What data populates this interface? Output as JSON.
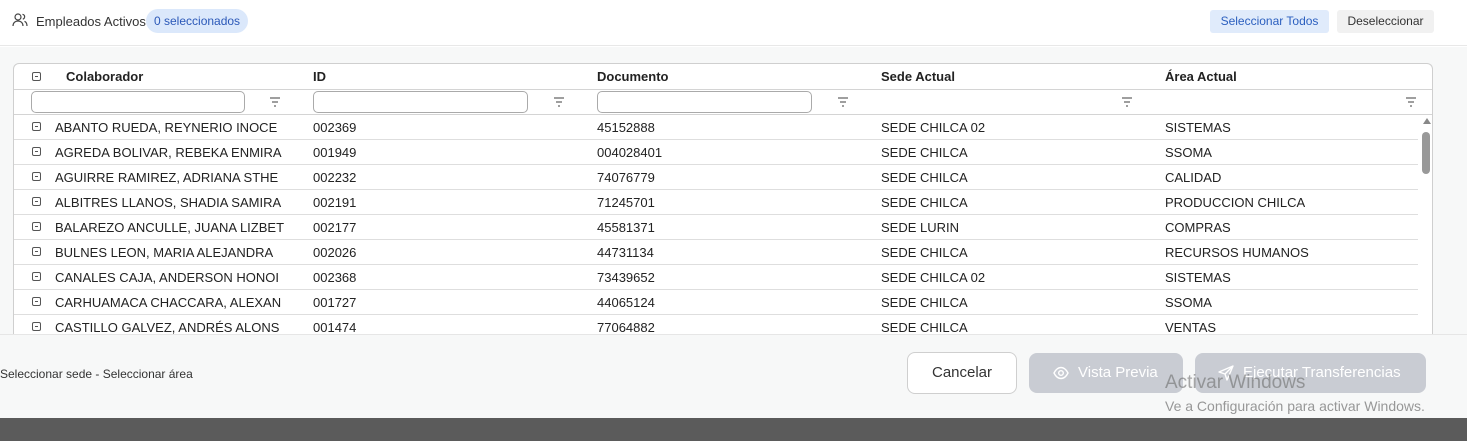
{
  "header": {
    "title": "Empleados Activos",
    "selected_badge": "0 seleccionados",
    "select_all_label": "Seleccionar Todos",
    "deselect_label": "Deseleccionar",
    "icon": "users-icon"
  },
  "grid": {
    "columns": [
      "Colaborador",
      "ID",
      "Documento",
      "Sede Actual",
      "Área Actual"
    ],
    "rows": [
      [
        "ABANTO RUEDA, REYNERIO INOCE",
        "002369",
        "45152888",
        "SEDE CHILCA 02",
        "SISTEMAS"
      ],
      [
        "AGREDA BOLIVAR, REBEKA ENMIRA",
        "001949",
        "004028401",
        "SEDE CHILCA",
        "SSOMA"
      ],
      [
        "AGUIRRE RAMIREZ, ADRIANA STHE",
        "002232",
        "74076779",
        "SEDE CHILCA",
        "CALIDAD"
      ],
      [
        "ALBITRES LLANOS, SHADIA SAMIRA",
        "002191",
        "71245701",
        "SEDE CHILCA",
        "PRODUCCION CHILCA"
      ],
      [
        "BALAREZO ANCULLE, JUANA LIZBET",
        "002177",
        "45581371",
        "SEDE LURIN",
        "COMPRAS"
      ],
      [
        "BULNES LEON, MARIA ALEJANDRA",
        "002026",
        "44731134",
        "SEDE CHILCA",
        "RECURSOS HUMANOS"
      ],
      [
        "CANALES CAJA, ANDERSON HONOI",
        "002368",
        "73439652",
        "SEDE CHILCA 02",
        "SISTEMAS"
      ],
      [
        "CARHUAMACA CHACCARA, ALEXAN",
        "001727",
        "44065124",
        "SEDE CHILCA",
        "SSOMA"
      ],
      [
        "CASTILLO GALVEZ, ANDRÉS ALONS",
        "001474",
        "77064882",
        "SEDE CHILCA",
        "VENTAS"
      ]
    ]
  },
  "footer": {
    "summary": "Seleccionar sede - Seleccionar área",
    "cancel_label": "Cancelar",
    "preview_label": "Vista Previa",
    "execute_label": "Ejecutar Transferencias",
    "preview_icon": "eye-icon",
    "execute_icon": "send-icon"
  },
  "watermark": {
    "title": "Activar Windows",
    "subtitle": "Ve a Configuración para activar Windows."
  },
  "colors": {
    "accent": "#2b5fbf",
    "badge_bg": "#dbe8fb",
    "disabled_button": "#c9ccd3",
    "overlay": "#5b5b5b"
  }
}
